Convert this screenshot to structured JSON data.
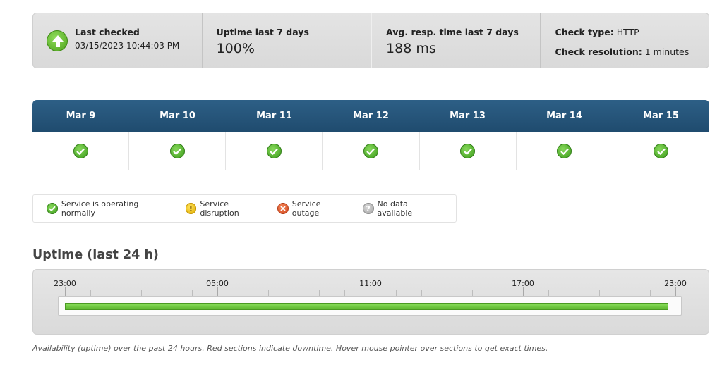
{
  "summary": {
    "last_checked_label": "Last checked",
    "last_checked_value": "03/15/2023 10:44:03 PM",
    "uptime_label": "Uptime last 7 days",
    "uptime_value": "100%",
    "avg_resp_label": "Avg. resp. time last 7 days",
    "avg_resp_value": "188 ms",
    "check_type_label": "Check type:",
    "check_type_value": "HTTP",
    "check_resolution_label": "Check resolution:",
    "check_resolution_value": "1 minutes",
    "status_icon": "arrow-up-icon"
  },
  "calendar": {
    "days": [
      {
        "label": "Mar 9",
        "status": "ok"
      },
      {
        "label": "Mar 10",
        "status": "ok"
      },
      {
        "label": "Mar 11",
        "status": "ok"
      },
      {
        "label": "Mar 12",
        "status": "ok"
      },
      {
        "label": "Mar 13",
        "status": "ok"
      },
      {
        "label": "Mar 14",
        "status": "ok"
      },
      {
        "label": "Mar 15",
        "status": "ok"
      }
    ],
    "header_color": "#245479",
    "ok_color": "#4ea31d"
  },
  "legend": {
    "normal": "Service is operating normally",
    "disruption": "Service disruption",
    "outage": "Service outage",
    "no_data": "No data available"
  },
  "uptime24": {
    "title": "Uptime (last 24 h)",
    "tick_labels": [
      "23:00",
      "05:00",
      "11:00",
      "17:00",
      "23:00"
    ],
    "uptime_fraction": 1.0,
    "up_color": "#6cc23a",
    "caption": "Availability (uptime) over the past 24 hours. Red sections indicate downtime. Hover mouse pointer over sections to get exact times."
  }
}
